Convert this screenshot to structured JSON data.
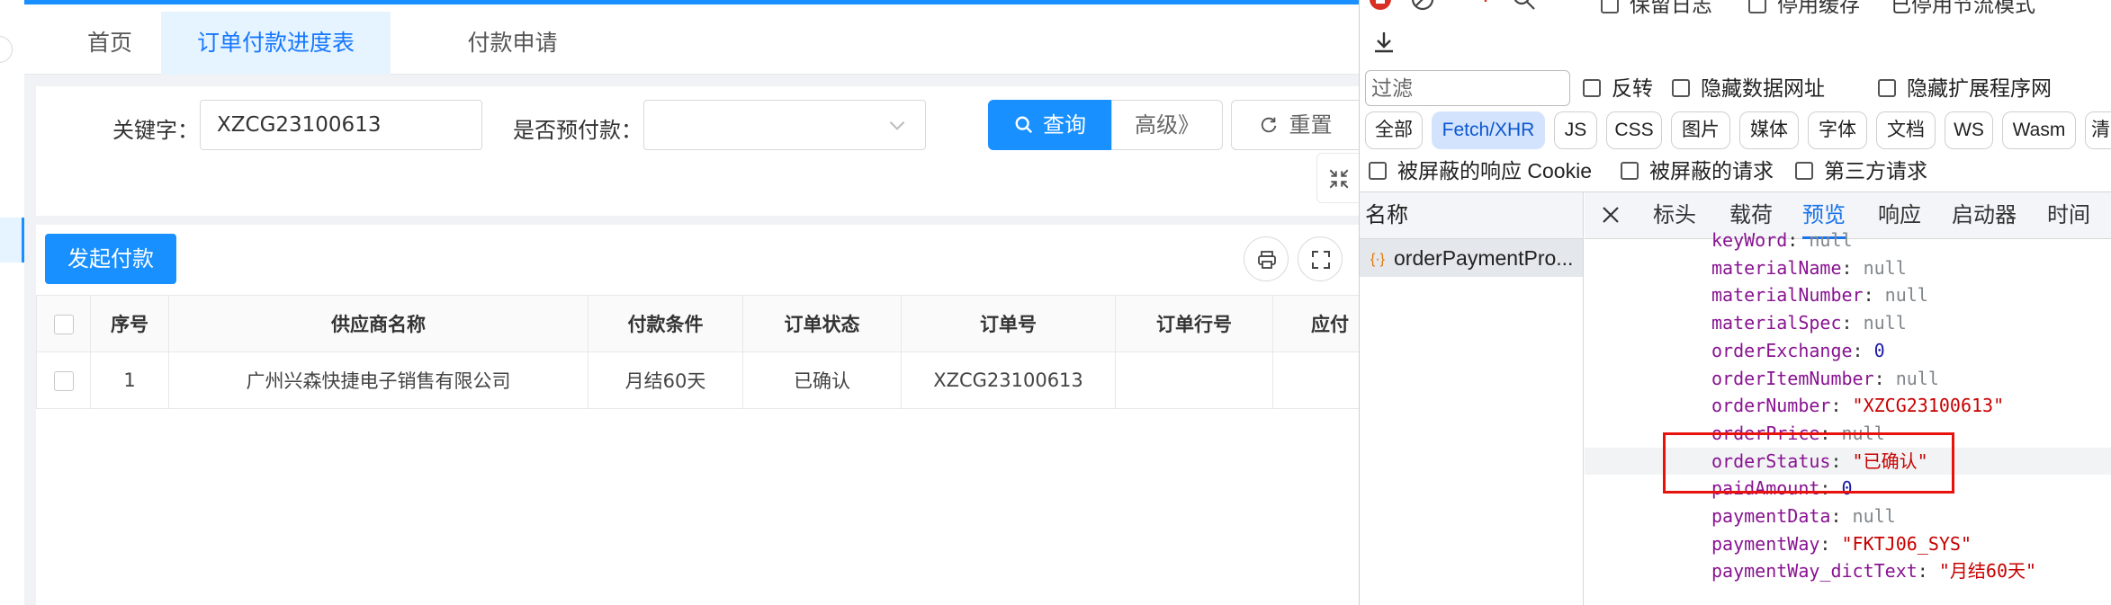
{
  "app": {
    "tabs": [
      {
        "label": "首页",
        "active": false
      },
      {
        "label": "订单付款进度表",
        "active": true
      },
      {
        "label": "付款申请",
        "active": false
      }
    ],
    "search": {
      "keyword_label": "关键字：",
      "keyword_value": "XZCG23100613",
      "prepay_label": "是否预付款：",
      "prepay_value": "",
      "query_label": "查询",
      "advanced_label": "高级》",
      "reset_label": "重置"
    },
    "toolbar": {
      "launch_label": "发起付款"
    },
    "table": {
      "columns": [
        "序号",
        "供应商名称",
        "付款条件",
        "订单状态",
        "订单号",
        "订单行号",
        "应付"
      ],
      "rows": [
        {
          "index": "1",
          "supplier": "广州兴森快捷电子销售有限公司",
          "terms": "月结60天",
          "status": "已确认",
          "order_no": "XZCG23100613",
          "line_no": "",
          "payable": ""
        }
      ]
    },
    "colors": {
      "primary": "#1890ff",
      "tab_active_bg": "#e6f4ff"
    }
  },
  "devtools": {
    "top_fragments": [
      "保留日志",
      "停用缓存",
      "已停用节流模式"
    ],
    "filter_placeholder": "过滤",
    "filter_checks": [
      "反转",
      "隐藏数据网址",
      "隐藏扩展程序网"
    ],
    "type_pills": [
      {
        "label": "全部",
        "active": false
      },
      {
        "label": "Fetch/XHR",
        "active": true
      },
      {
        "label": "JS",
        "active": false
      },
      {
        "label": "CSS",
        "active": false
      },
      {
        "label": "图片",
        "active": false
      },
      {
        "label": "媒体",
        "active": false
      },
      {
        "label": "字体",
        "active": false
      },
      {
        "label": "文档",
        "active": false
      },
      {
        "label": "WS",
        "active": false
      },
      {
        "label": "Wasm",
        "active": false
      },
      {
        "label": "清单",
        "active": false
      }
    ],
    "block_checks": [
      "被屏蔽的响应 Cookie",
      "被屏蔽的请求",
      "第三方请求"
    ],
    "name_header": "名称",
    "request_name": "orderPaymentPro...",
    "detail_tabs": [
      {
        "label": "标头",
        "active": false
      },
      {
        "label": "载荷",
        "active": false
      },
      {
        "label": "预览",
        "active": true
      },
      {
        "label": "响应",
        "active": false
      },
      {
        "label": "启动器",
        "active": false
      },
      {
        "label": "时间",
        "active": false
      }
    ],
    "json_lines": [
      {
        "key": "keyWord",
        "value": "null",
        "type": "null"
      },
      {
        "key": "materialName",
        "value": "null",
        "type": "null"
      },
      {
        "key": "materialNumber",
        "value": "null",
        "type": "null"
      },
      {
        "key": "materialSpec",
        "value": "null",
        "type": "null"
      },
      {
        "key": "orderExchange",
        "value": "0",
        "type": "num"
      },
      {
        "key": "orderItemNumber",
        "value": "null",
        "type": "null"
      },
      {
        "key": "orderNumber",
        "value": "\"XZCG23100613\"",
        "type": "str"
      },
      {
        "key": "orderPrice",
        "value": "null",
        "type": "null"
      },
      {
        "key": "orderStatus",
        "value": "\"已确认\"",
        "type": "str"
      },
      {
        "key": "paidAmount",
        "value": "0",
        "type": "num"
      },
      {
        "key": "paymentData",
        "value": "null",
        "type": "null"
      },
      {
        "key": "paymentWay",
        "value": "\"FKTJ06_SYS\"",
        "type": "str"
      },
      {
        "key": "paymentWay_dictText",
        "value": "\"月结60天\"",
        "type": "str"
      }
    ],
    "colors": {
      "highlight_box": "#e8120c",
      "active_tab": "#1a73e8"
    }
  }
}
